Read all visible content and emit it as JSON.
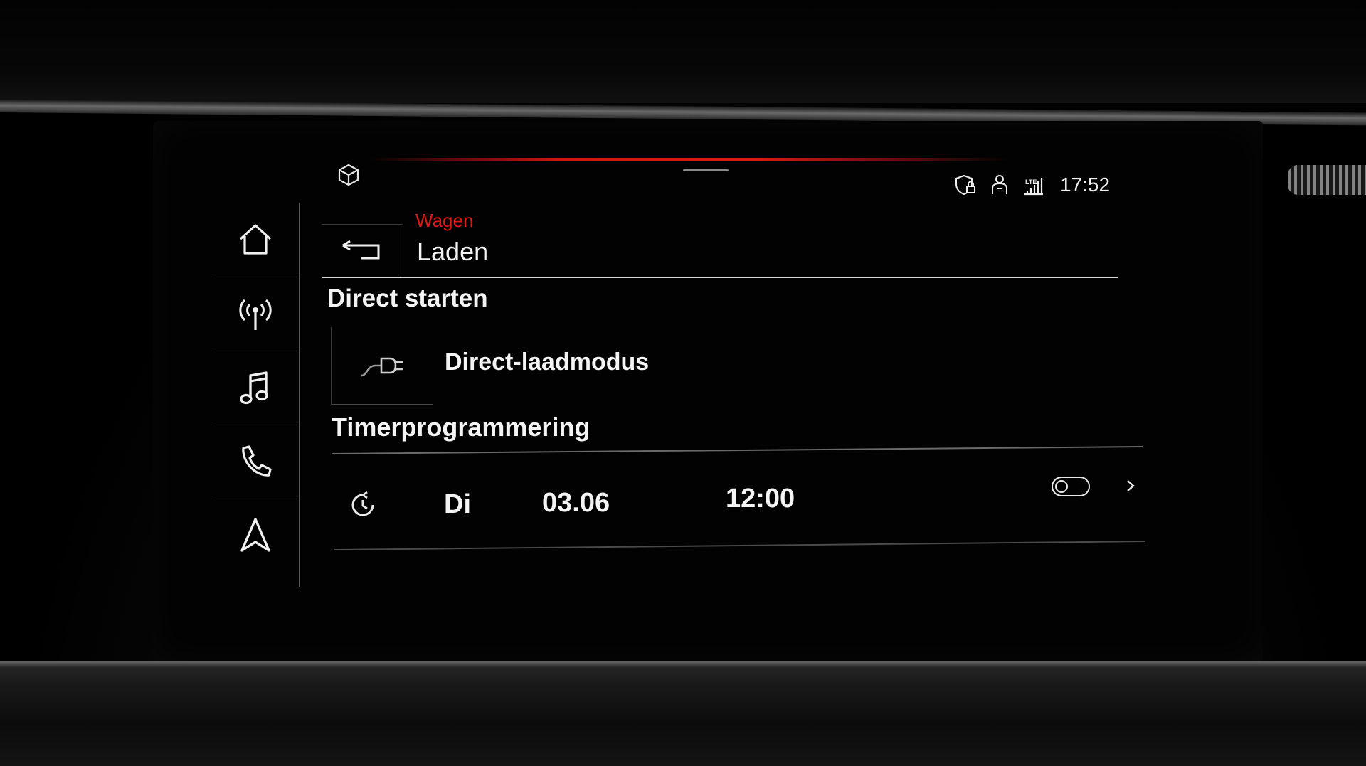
{
  "status": {
    "time": "17:52",
    "icons": [
      "shield-lock-icon",
      "person-icon",
      "lte-signal-icon"
    ]
  },
  "header": {
    "breadcrumb": "Wagen",
    "title": "Laden"
  },
  "sidebar": {
    "items": [
      {
        "icon": "home-icon"
      },
      {
        "icon": "radio-icon"
      },
      {
        "icon": "music-icon"
      },
      {
        "icon": "phone-icon"
      },
      {
        "icon": "navigation-icon"
      }
    ]
  },
  "sections": {
    "direct_title": "Direct starten",
    "direct_mode_label": "Direct-laadmodus",
    "timer_title": "Timerprogrammering"
  },
  "timer": {
    "day": "Di",
    "date": "03.06",
    "time": "12:00",
    "enabled": false
  },
  "colors": {
    "accent": "#e01818",
    "text": "#f4f4f4",
    "background": "#020202"
  }
}
